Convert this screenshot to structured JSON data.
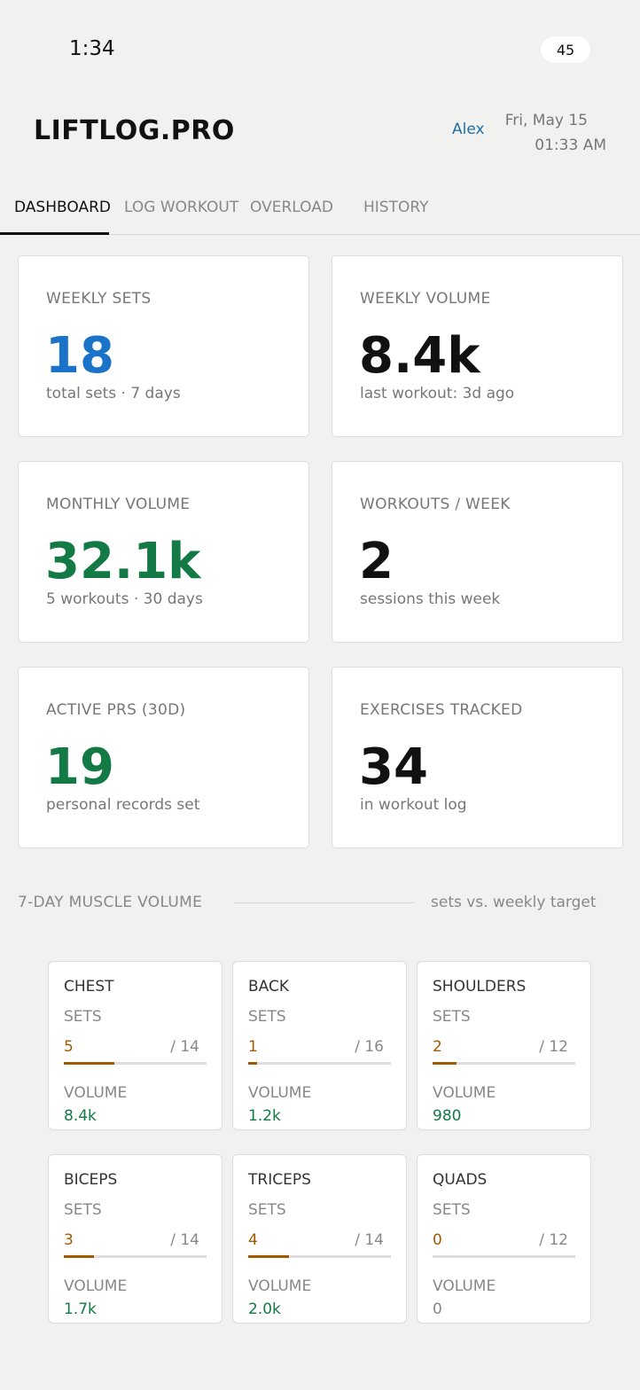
{
  "status": {
    "time": "1:34",
    "battery": "45"
  },
  "header": {
    "title": "LIFTLOG.PRO",
    "user": "Alex",
    "date": "Fri, May 15",
    "time": "01:33 AM"
  },
  "tabs": [
    {
      "label": "DASHBOARD",
      "active": true
    },
    {
      "label": "LOG WORKOUT",
      "active": false
    },
    {
      "label": "OVERLOAD",
      "active": false
    },
    {
      "label": "HISTORY",
      "active": false
    }
  ],
  "stats": [
    {
      "label": "WEEKLY SETS",
      "value": "18",
      "sub": "total sets · 7 days",
      "color": "#1a73c9"
    },
    {
      "label": "WEEKLY VOLUME",
      "value": "8.4k",
      "sub": "last workout: 3d ago",
      "color": "#111111"
    },
    {
      "label": "MONTHLY VOLUME",
      "value": "32.1k",
      "sub": "5 workouts · 30 days",
      "color": "#137a45"
    },
    {
      "label": "WORKOUTS / WEEK",
      "value": "2",
      "sub": "sessions this week",
      "color": "#111111"
    },
    {
      "label": "ACTIVE PRS (30D)",
      "value": "19",
      "sub": "personal records set",
      "color": "#137a45"
    },
    {
      "label": "EXERCISES TRACKED",
      "value": "34",
      "sub": "in workout log",
      "color": "#111111"
    }
  ],
  "muscle_section": {
    "title": "7-DAY MUSCLE VOLUME",
    "note": "sets vs. weekly target",
    "sets_label": "SETS",
    "volume_label": "VOLUME",
    "muscles": [
      {
        "name": "CHEST",
        "sets": "5",
        "target": "/ 14",
        "volume": "8.4k",
        "progress": 0.357
      },
      {
        "name": "BACK",
        "sets": "1",
        "target": "/ 16",
        "volume": "1.2k",
        "progress": 0.0625
      },
      {
        "name": "SHOULDERS",
        "sets": "2",
        "target": "/ 12",
        "volume": "980",
        "progress": 0.167
      },
      {
        "name": "BICEPS",
        "sets": "3",
        "target": "/ 14",
        "volume": "1.7k",
        "progress": 0.214
      },
      {
        "name": "TRICEPS",
        "sets": "4",
        "target": "/ 14",
        "volume": "2.0k",
        "progress": 0.286
      },
      {
        "name": "QUADS",
        "sets": "0",
        "target": "/ 12",
        "volume": "0",
        "progress": 0
      }
    ]
  },
  "colors": {
    "accent_blue": "#1a73c9",
    "green": "#137a45",
    "amber": "#a05a00",
    "link": "#1f6fa8"
  }
}
